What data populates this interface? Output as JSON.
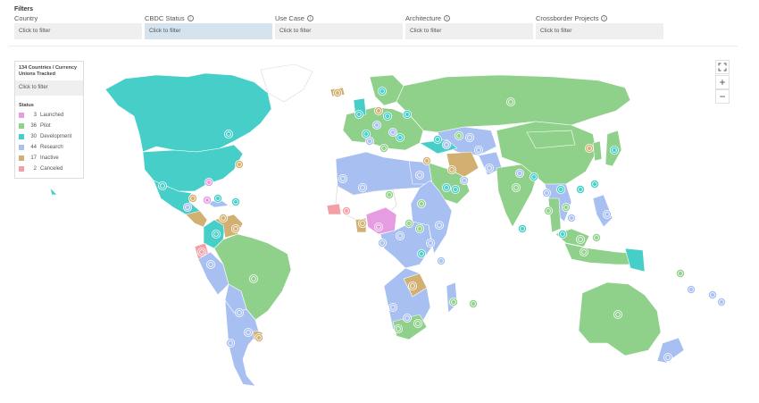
{
  "filters": {
    "title": "Filters",
    "fields": [
      {
        "label": "Country",
        "value": "Click to filter",
        "info": false
      },
      {
        "label": "CBDC Status",
        "value": "Click to filter",
        "info": true
      },
      {
        "label": "Use Case",
        "value": "Click to filter",
        "info": true
      },
      {
        "label": "Architecture",
        "value": "Click to filter",
        "info": true
      },
      {
        "label": "Crossborder Projects",
        "value": "Click to filter",
        "info": true
      }
    ]
  },
  "legend": {
    "title": "134 Countries / Currency Unions Tracked",
    "search": "Click to filter",
    "status_label": "Status",
    "items": [
      {
        "count": "3",
        "label": "Launched",
        "color": "#e59ce1"
      },
      {
        "count": "36",
        "label": "Pilot",
        "color": "#8fd18a"
      },
      {
        "count": "30",
        "label": "Development",
        "color": "#45cfc8"
      },
      {
        "count": "44",
        "label": "Research",
        "color": "#a8bff2"
      },
      {
        "count": "17",
        "label": "Inactive",
        "color": "#d2b072"
      },
      {
        "count": "2",
        "label": "Canceled",
        "color": "#f2a0a6"
      }
    ]
  },
  "controls": {
    "fullscreen_icon": "fullscreen-icon",
    "zoom_in": "+",
    "zoom_out": "−"
  },
  "colors": {
    "launched": "#e59ce1",
    "pilot": "#8fd18a",
    "development": "#45cfc8",
    "research": "#a8bff2",
    "inactive": "#d2b072",
    "canceled": "#f2a0a6",
    "none": "#ffffff",
    "border": "#bdbdbd"
  }
}
